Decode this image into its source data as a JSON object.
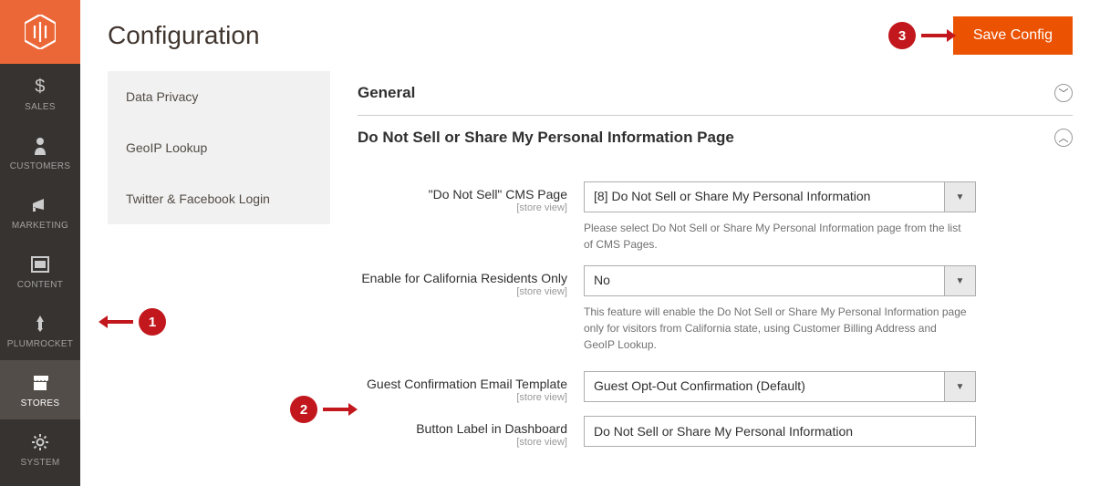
{
  "brand": {
    "name": "Magento"
  },
  "nav": {
    "items": [
      {
        "label": "SALES"
      },
      {
        "label": "CUSTOMERS"
      },
      {
        "label": "MARKETING"
      },
      {
        "label": "CONTENT"
      },
      {
        "label": "PLUMROCKET"
      },
      {
        "label": "STORES"
      },
      {
        "label": "SYSTEM"
      }
    ]
  },
  "header": {
    "title": "Configuration",
    "save_label": "Save Config"
  },
  "tabs": {
    "items": [
      {
        "label": "Data Privacy"
      },
      {
        "label": "GeoIP Lookup"
      },
      {
        "label": "Twitter & Facebook Login"
      }
    ]
  },
  "sections": {
    "general_title": "General",
    "dns_title": "Do Not Sell or Share My Personal Information Page"
  },
  "fields": {
    "scope": "[store view]",
    "cms_page": {
      "label": "\"Do Not Sell\" CMS Page",
      "value": "[8] Do Not Sell or Share My Personal Information",
      "note": "Please select Do Not Sell or Share My Personal Information page from the list of CMS Pages."
    },
    "california": {
      "label": "Enable for California Residents Only",
      "value": "No",
      "note": "This feature will enable the Do Not Sell or Share My Personal Information page only for visitors from California state, using Customer Billing Address and GeoIP Lookup."
    },
    "guest_tpl": {
      "label": "Guest Confirmation Email Template",
      "value": "Guest Opt-Out Confirmation (Default)"
    },
    "btn_label": {
      "label": "Button Label in Dashboard",
      "value": "Do Not Sell or Share My Personal Information"
    }
  },
  "callouts": {
    "one": "1",
    "two": "2",
    "three": "3"
  }
}
